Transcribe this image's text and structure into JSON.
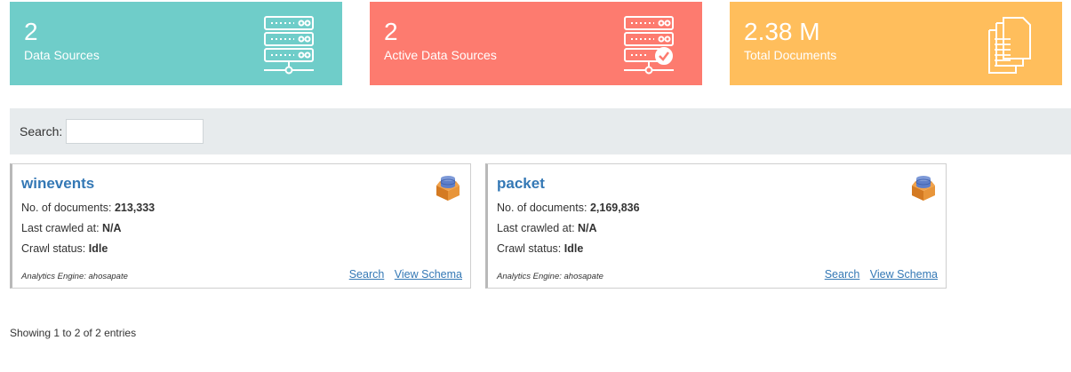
{
  "stats": [
    {
      "value": "2",
      "label": "Data Sources",
      "icon": "server-icon"
    },
    {
      "value": "2",
      "label": "Active Data Sources",
      "icon": "server-check-icon"
    },
    {
      "value": "2.38 M",
      "label": "Total Documents",
      "icon": "documents-icon"
    }
  ],
  "search": {
    "label": "Search:",
    "placeholder": ""
  },
  "cards": [
    {
      "title": "winevents",
      "docs_label": "No. of documents:",
      "docs_value": "213,333",
      "crawl_label": "Last crawled at:",
      "crawl_value": "N/A",
      "status_label": "Crawl status:",
      "status_value": "Idle",
      "engine": "Analytics Engine: ahosapate",
      "search_link": "Search",
      "schema_link": "View Schema"
    },
    {
      "title": "packet",
      "docs_label": "No. of documents:",
      "docs_value": "2,169,836",
      "crawl_label": "Last crawled at:",
      "crawl_value": "N/A",
      "status_label": "Crawl status:",
      "status_value": "Idle",
      "engine": "Analytics Engine: ahosapate",
      "search_link": "Search",
      "schema_link": "View Schema"
    }
  ],
  "footer": {
    "info": "Showing 1 to 2 of 2 entries"
  }
}
